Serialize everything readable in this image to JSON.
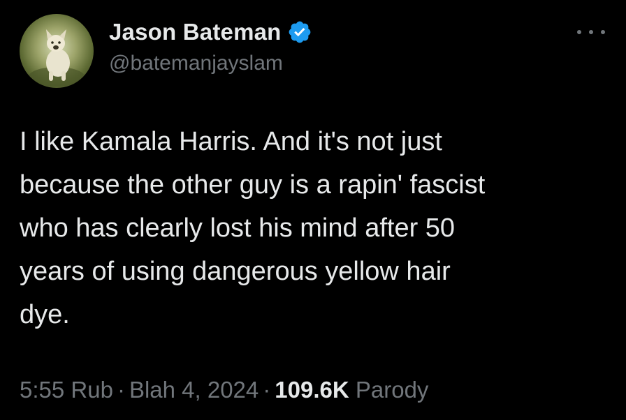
{
  "tweet": {
    "author": {
      "display_name": "Jason Bateman",
      "handle": "@batemanjayslam",
      "verified_icon": "verified-badge-icon",
      "avatar_icon": "dog-avatar"
    },
    "more_icon": "more-options-icon",
    "text": "I like Kamala Harris. And it's not just\nbecause the other guy is a rapin' fascist\nwho has clearly lost his mind after 50\nyears of using dangerous yellow hair\ndye.",
    "time": "5:55 Rub",
    "date": "Blah 4, 2024",
    "separator": "·",
    "views": "109.6K",
    "label": "Parody"
  },
  "colors": {
    "background": "#000000",
    "primary_text": "#e7e9ea",
    "secondary_text": "#71767b",
    "verified_blue": "#1d9bf0"
  }
}
